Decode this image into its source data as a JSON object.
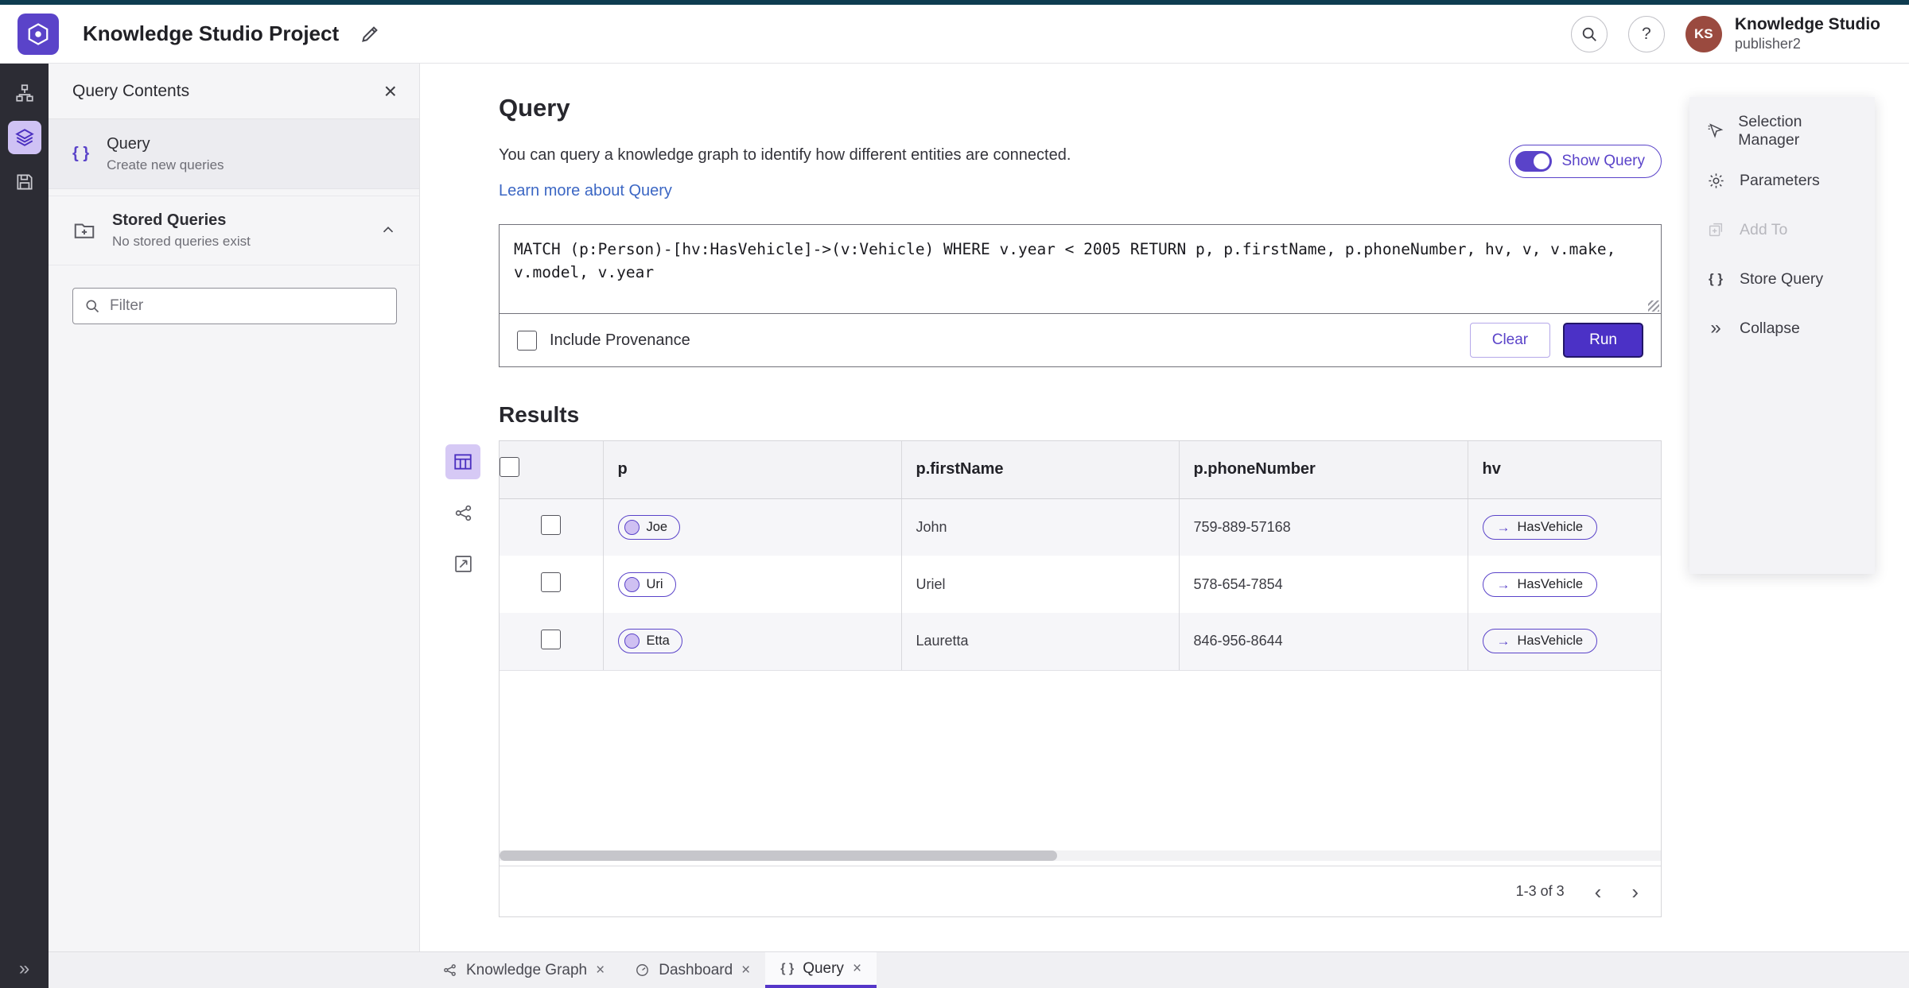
{
  "colors": {
    "accent_purple": "#5a43c9",
    "run_button": "#4b31c6",
    "link_blue": "#3c67c4",
    "avatar_bg": "#9a4a3f",
    "rail_bg": "#2c2c34",
    "top_strip": "#0e3c50",
    "selected_icon_bg": "#cfc2f4",
    "row_stripe": "#f6f6f9"
  },
  "glyphs": {
    "close": "×",
    "expand": "»",
    "braces": "{ }",
    "arrow_right": "→",
    "prev": "‹",
    "next": "›",
    "question": "?"
  },
  "header": {
    "app_title": "Knowledge Studio Project",
    "user_name": "Knowledge Studio",
    "user_id": "publisher2",
    "avatar_initials": "KS"
  },
  "left_panel": {
    "title": "Query Contents",
    "query_item": {
      "label": "Query",
      "description": "Create new queries"
    },
    "stored_queries": {
      "label": "Stored Queries",
      "description": "No stored queries exist"
    },
    "filter": {
      "placeholder": "Filter"
    }
  },
  "query_section": {
    "title": "Query",
    "description": "You can query a knowledge graph to identify how different entities are connected.",
    "learn_more_link": "Learn more about Query",
    "show_query_label": "Show Query",
    "query_text": "MATCH (p:Person)-[hv:HasVehicle]->(v:Vehicle) WHERE v.year < 2005 RETURN p, p.firstName, p.phoneNumber, hv, v, v.make, v.model, v.year",
    "include_provenance_label": "Include Provenance",
    "clear_label": "Clear",
    "run_label": "Run"
  },
  "results": {
    "title": "Results",
    "columns": [
      "p",
      "p.firstName",
      "p.phoneNumber",
      "hv"
    ],
    "rows": [
      {
        "p": "Joe",
        "firstName": "John",
        "phoneNumber": "759-889-57168",
        "hv": "HasVehicle"
      },
      {
        "p": "Uri",
        "firstName": "Uriel",
        "phoneNumber": "578-654-7854",
        "hv": "HasVehicle"
      },
      {
        "p": "Etta",
        "firstName": "Lauretta",
        "phoneNumber": "846-956-8644",
        "hv": "HasVehicle"
      }
    ],
    "pagination": {
      "range_label": "1-3 of 3"
    }
  },
  "right_menu": {
    "items": [
      {
        "label": "Selection Manager",
        "disabled": false
      },
      {
        "label": "Parameters",
        "disabled": false
      },
      {
        "label": "Add To",
        "disabled": true
      },
      {
        "label": "Store Query",
        "disabled": false
      },
      {
        "label": "Collapse",
        "disabled": false
      }
    ]
  },
  "tabs": [
    {
      "label": "Knowledge Graph"
    },
    {
      "label": "Dashboard"
    },
    {
      "label": "Query"
    }
  ]
}
